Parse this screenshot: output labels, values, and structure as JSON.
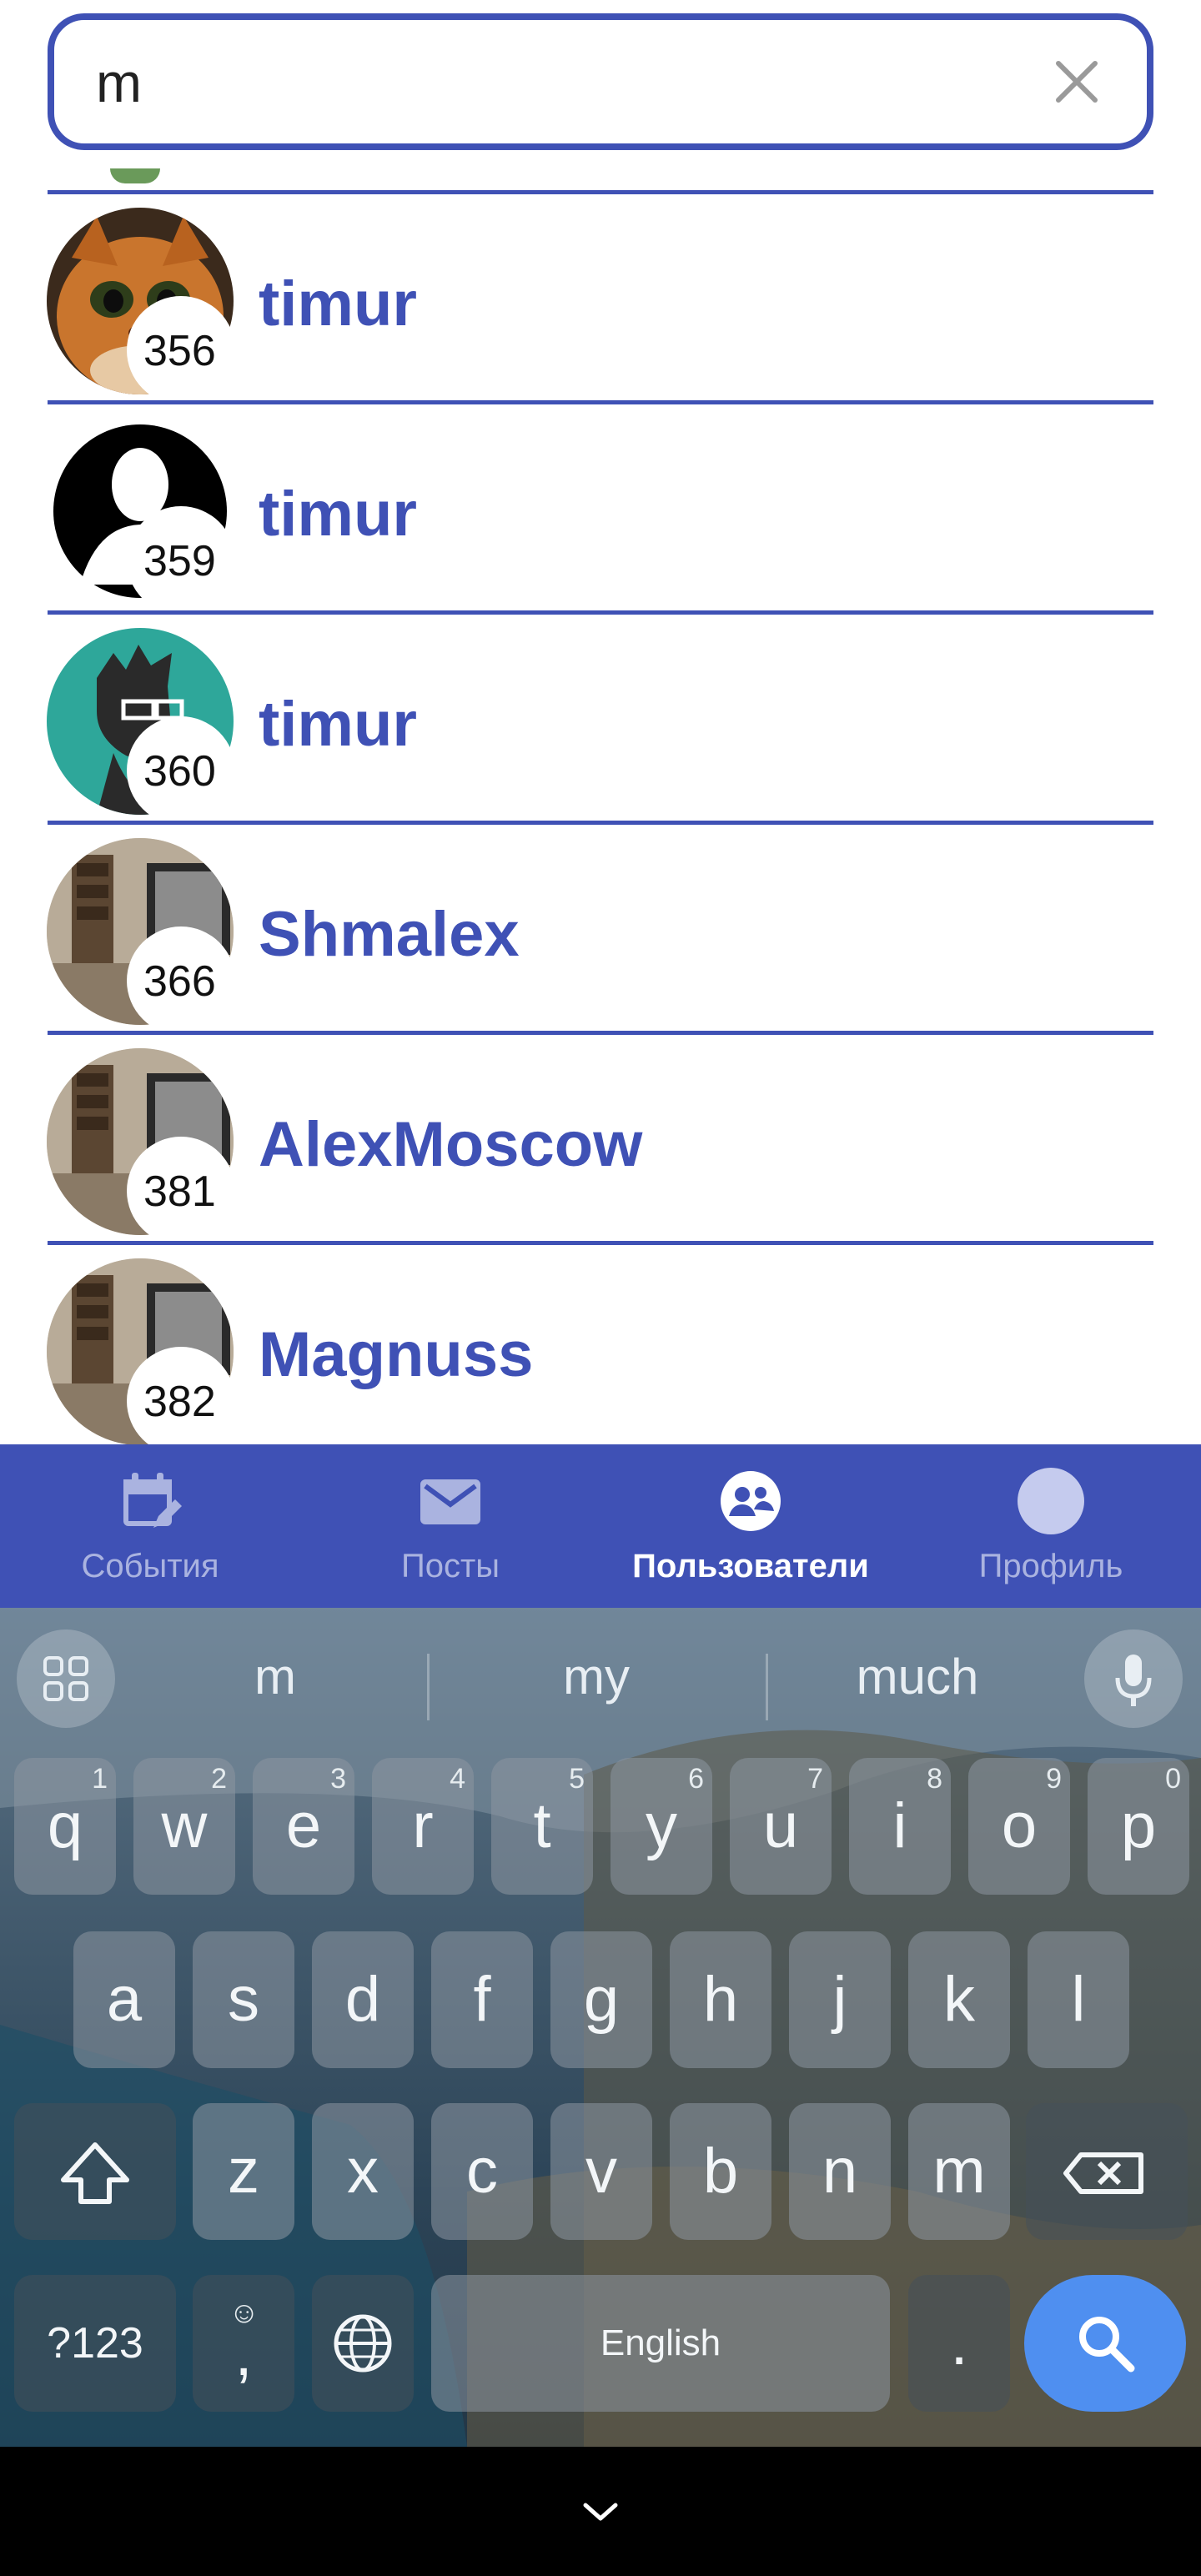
{
  "search": {
    "value": "m"
  },
  "users": [
    {
      "name": "timur",
      "id": "356",
      "avatar": "cat-avatar-icon"
    },
    {
      "name": "timur",
      "id": "359",
      "avatar": "person-silhouette-icon"
    },
    {
      "name": "timur",
      "id": "360",
      "avatar": "cartoon-face-icon"
    },
    {
      "name": "Shmalex",
      "id": "366",
      "avatar": "room-photo-icon"
    },
    {
      "name": "AlexMoscow",
      "id": "381",
      "avatar": "room-photo-icon"
    },
    {
      "name": "Magnuss",
      "id": "382",
      "avatar": "room-photo-icon"
    }
  ],
  "bottom_nav": {
    "items": [
      {
        "label": "События",
        "icon": "calendar-edit-icon",
        "active": false
      },
      {
        "label": "Посты",
        "icon": "mail-icon",
        "active": false
      },
      {
        "label": "Пользователи",
        "icon": "users-icon",
        "active": true
      },
      {
        "label": "Профиль",
        "icon": "profile-avatar-icon",
        "active": false
      }
    ],
    "background": "#3f51b5"
  },
  "keyboard": {
    "suggestions": [
      "m",
      "my",
      "much"
    ],
    "row1": [
      {
        "key": "q",
        "hint": "1"
      },
      {
        "key": "w",
        "hint": "2"
      },
      {
        "key": "e",
        "hint": "3"
      },
      {
        "key": "r",
        "hint": "4"
      },
      {
        "key": "t",
        "hint": "5"
      },
      {
        "key": "y",
        "hint": "6"
      },
      {
        "key": "u",
        "hint": "7"
      },
      {
        "key": "i",
        "hint": "8"
      },
      {
        "key": "o",
        "hint": "9"
      },
      {
        "key": "p",
        "hint": "0"
      }
    ],
    "row2": [
      "a",
      "s",
      "d",
      "f",
      "g",
      "h",
      "j",
      "k",
      "l"
    ],
    "row3": [
      "z",
      "x",
      "c",
      "v",
      "b",
      "n",
      "m"
    ],
    "symbols_key": "?123",
    "comma_key": ",",
    "emoji_hint": "☺",
    "space_label": "English",
    "period_key": "."
  },
  "colors": {
    "accent": "#3f51b5",
    "search_key": "#4f8ff0"
  }
}
